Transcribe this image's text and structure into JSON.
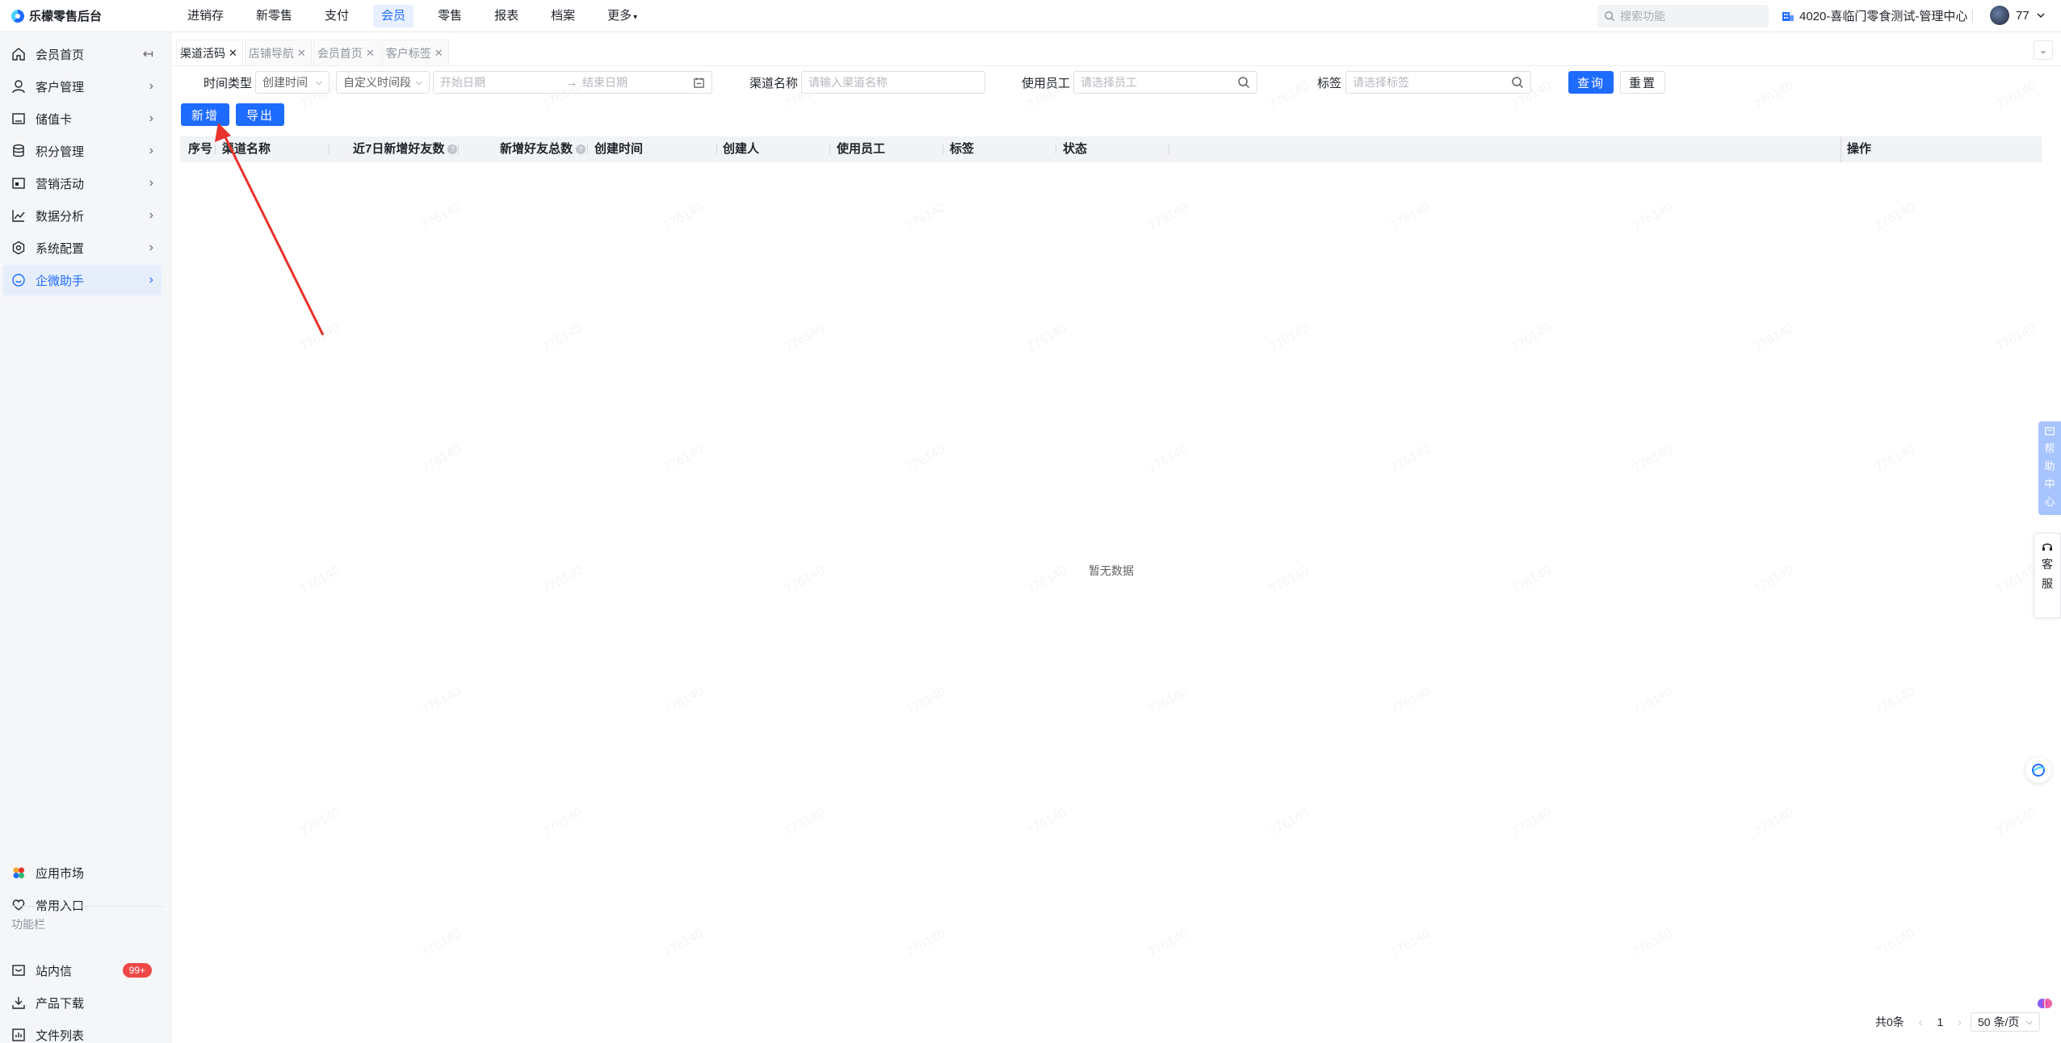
{
  "app": {
    "brand": "乐檬零售后台"
  },
  "topnav": {
    "items": [
      "进销存",
      "新零售",
      "支付",
      "会员",
      "零售",
      "报表",
      "档案",
      "更多"
    ],
    "search_placeholder": "搜索功能",
    "org": "4020-喜临门零食测试-管理中心",
    "user": "77"
  },
  "sidebar": {
    "items": [
      {
        "label": "会员首页",
        "icon": "home-icon"
      },
      {
        "label": "客户管理",
        "icon": "user-icon"
      },
      {
        "label": "储值卡",
        "icon": "card-icon"
      },
      {
        "label": "积分管理",
        "icon": "coins-icon"
      },
      {
        "label": "营销活动",
        "icon": "promo-icon"
      },
      {
        "label": "数据分析",
        "icon": "chart-icon"
      },
      {
        "label": "系统配置",
        "icon": "settings-icon"
      },
      {
        "label": "企微助手",
        "icon": "chat-icon"
      }
    ],
    "bottom": [
      {
        "label": "应用市场",
        "icon": "apps-icon"
      },
      {
        "label": "常用入口",
        "icon": "heart-icon"
      }
    ],
    "section_title": "功能栏",
    "tools": [
      {
        "label": "站内信",
        "icon": "mail-icon",
        "badge": "99+"
      },
      {
        "label": "产品下载",
        "icon": "download-icon"
      },
      {
        "label": "文件列表",
        "icon": "file-list-icon"
      }
    ]
  },
  "tabs": [
    "渠道活码",
    "店铺导航",
    "会员首页",
    "客户标签"
  ],
  "filters": {
    "time_type_label": "时间类型",
    "time_type_value": "创建时间",
    "period_value": "自定义时间段",
    "start_placeholder": "开始日期",
    "end_placeholder": "结束日期",
    "channel_label": "渠道名称",
    "channel_placeholder": "请输入渠道名称",
    "staff_label": "使用员工",
    "staff_placeholder": "请选择员工",
    "tag_label": "标签",
    "tag_placeholder": "请选择标签",
    "query_button": "查询",
    "reset_button": "重置"
  },
  "actions": {
    "add_button": "新增",
    "export_button": "导出"
  },
  "table": {
    "columns": [
      "序号",
      "渠道名称",
      "近7日新增好友数",
      "新增好友总数",
      "创建时间",
      "创建人",
      "使用员工",
      "标签",
      "状态",
      "操作"
    ],
    "rows": [],
    "empty_text": "暂无数据"
  },
  "pagination": {
    "total": "共0条",
    "page": "1",
    "page_size": "50 条/页"
  },
  "floats": {
    "help": [
      "帮",
      "助",
      "中",
      "心"
    ],
    "kefu": [
      "客",
      "服"
    ]
  },
  "watermark": "776140",
  "colors": {
    "primary": "#1e6bff",
    "badge": "#f04848",
    "annotation_arrow": "#e8322b"
  }
}
